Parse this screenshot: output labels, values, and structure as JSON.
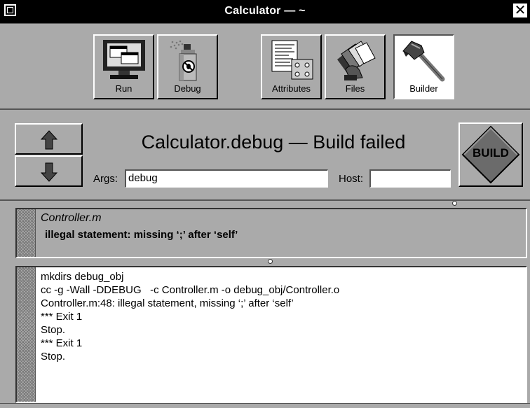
{
  "window": {
    "title": "Calculator — ~",
    "close_glyph": "✕"
  },
  "toolbar": {
    "buttons": [
      {
        "label": "Run",
        "icon": "computer-monitor-icon"
      },
      {
        "label": "Debug",
        "icon": "bug-spray-can-icon"
      },
      {
        "label": "Attributes",
        "icon": "attributes-inspector-icon"
      },
      {
        "label": "Files",
        "icon": "file-cards-icon"
      },
      {
        "label": "Builder",
        "icon": "hammer-icon",
        "selected": true
      }
    ]
  },
  "status": {
    "title": "Calculator.debug — Build failed",
    "args_label": "Args:",
    "args_value": "debug",
    "host_label": "Host:",
    "host_value": ""
  },
  "build_button": {
    "label": "BUILD",
    "color": "#6b6b6b"
  },
  "error_panel": {
    "file": "Controller.m",
    "message": "illegal statement: missing ‘;’ after ‘self’"
  },
  "log": {
    "lines": [
      "mkdirs debug_obj",
      "cc -g -Wall -DDEBUG   -c Controller.m -o debug_obj/Controller.o",
      "Controller.m:48: illegal statement, missing ‘;’ after ‘self’",
      "*** Exit 1",
      "Stop.",
      "*** Exit 1",
      "Stop."
    ]
  }
}
